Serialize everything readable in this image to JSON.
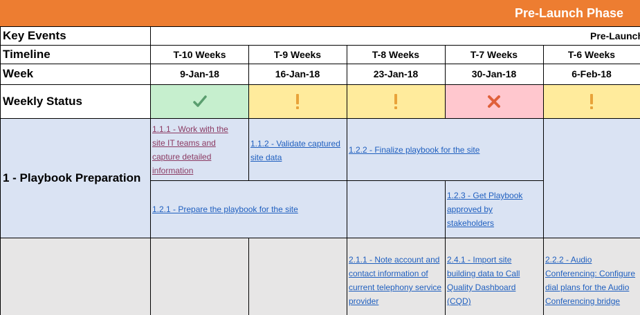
{
  "phase_title": "Pre-Launch Phase",
  "colors": {
    "phase_bar": "#ed7d31",
    "status_ok": "#c6efce",
    "status_warn": "#ffeb9c",
    "status_bad": "#ffc7ce",
    "section_blue": "#dae3f3",
    "section_gray": "#e7e6e6",
    "link_blue": "#1f5fbf",
    "link_visited": "#8b3a62"
  },
  "row_labels": {
    "key_events": "Key Events",
    "timeline": "Timeline",
    "week": "Week",
    "weekly_status": "Weekly Status"
  },
  "key_events_value": "Pre-Launch",
  "columns": [
    {
      "timeline": "T-10 Weeks",
      "week": "9-Jan-18",
      "status": "ok",
      "status_icon": "check-icon"
    },
    {
      "timeline": "T-9 Weeks",
      "week": "16-Jan-18",
      "status": "warn",
      "status_icon": "exclamation-icon"
    },
    {
      "timeline": "T-8 Weeks",
      "week": "23-Jan-18",
      "status": "warn",
      "status_icon": "exclamation-icon"
    },
    {
      "timeline": "T-7 Weeks",
      "week": "30-Jan-18",
      "status": "bad",
      "status_icon": "x-icon"
    },
    {
      "timeline": "T-6 Weeks",
      "week": "6-Feb-18",
      "status": "warn",
      "status_icon": "exclamation-icon"
    }
  ],
  "section1": {
    "label": "1 - Playbook Preparation",
    "tasks": {
      "t111": "1.1.1 - Work with the site IT teams and capture detailed information",
      "t112": "1.1.2 - Validate captured site data",
      "t122": "1.2.2 - Finalize playbook for the site",
      "t121": "1.2.1 - Prepare the playbook for the site",
      "t123": "1.2.3 - Get Playbook approved by stakeholders"
    }
  },
  "section2": {
    "tasks": {
      "t211": "2.1.1 - Note account and contact information of current telephony service provider",
      "t241": "2.4.1 - Import site building data to Call Quality Dashboard (CQD)",
      "t222": "2.2.2 - Audio Conferencing: Configure dial plans for the Audio Conferencing bridge"
    }
  }
}
